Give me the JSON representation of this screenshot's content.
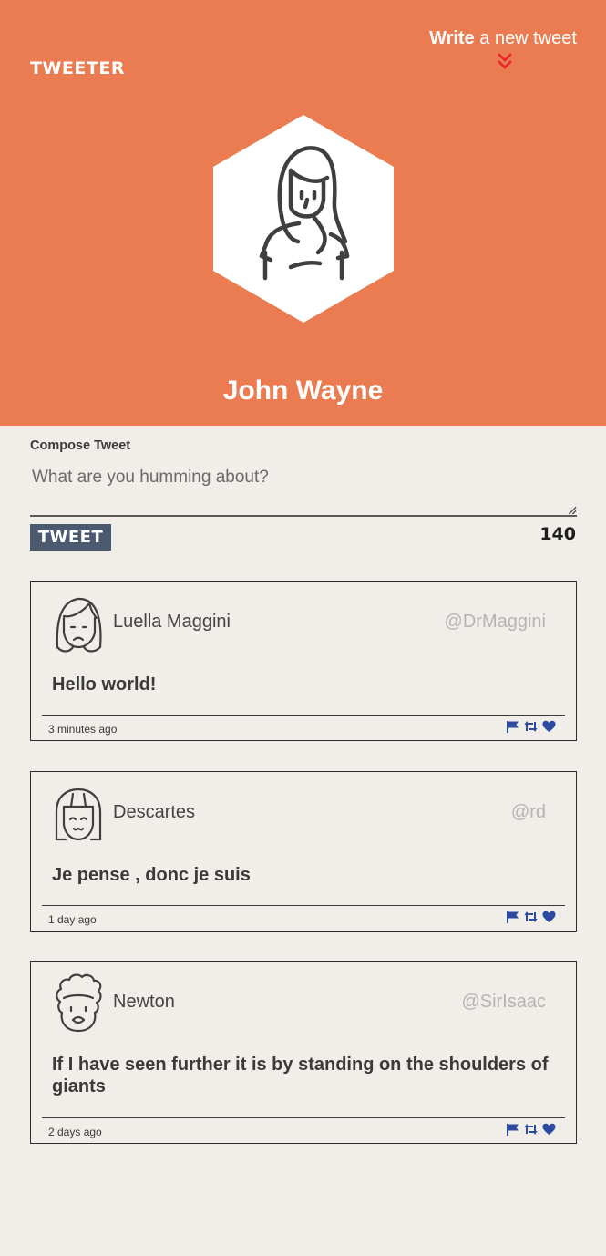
{
  "header": {
    "logo": "TWEETER",
    "write_bold": "Write",
    "write_rest": " a new tweet",
    "profile_name": "John Wayne"
  },
  "compose": {
    "label": "Compose Tweet",
    "placeholder": "What are you humming about?",
    "button_label": "TWEET",
    "counter": "140"
  },
  "tweets": [
    {
      "name": "Luella Maggini",
      "handle": "@DrMaggini",
      "text": "Hello world!",
      "time": "3 minutes ago"
    },
    {
      "name": "Descartes",
      "handle": "@rd",
      "text": "Je pense , donc je suis",
      "time": "1 day ago"
    },
    {
      "name": "Newton",
      "handle": "@SirIsaac",
      "text": "If I have seen further it is by standing on the shoulders of giants",
      "time": "2 days ago"
    }
  ],
  "colors": {
    "header_bg": "#eb7b51",
    "page_bg": "#f1eee9",
    "button_bg": "#4b5a6e",
    "action_icon": "#2d4aa0",
    "chevron": "#e8262b"
  },
  "icons": {
    "chevron": "double-chevron-down-icon",
    "flag": "flag-icon",
    "retweet": "retweet-icon",
    "like": "heart-icon"
  }
}
